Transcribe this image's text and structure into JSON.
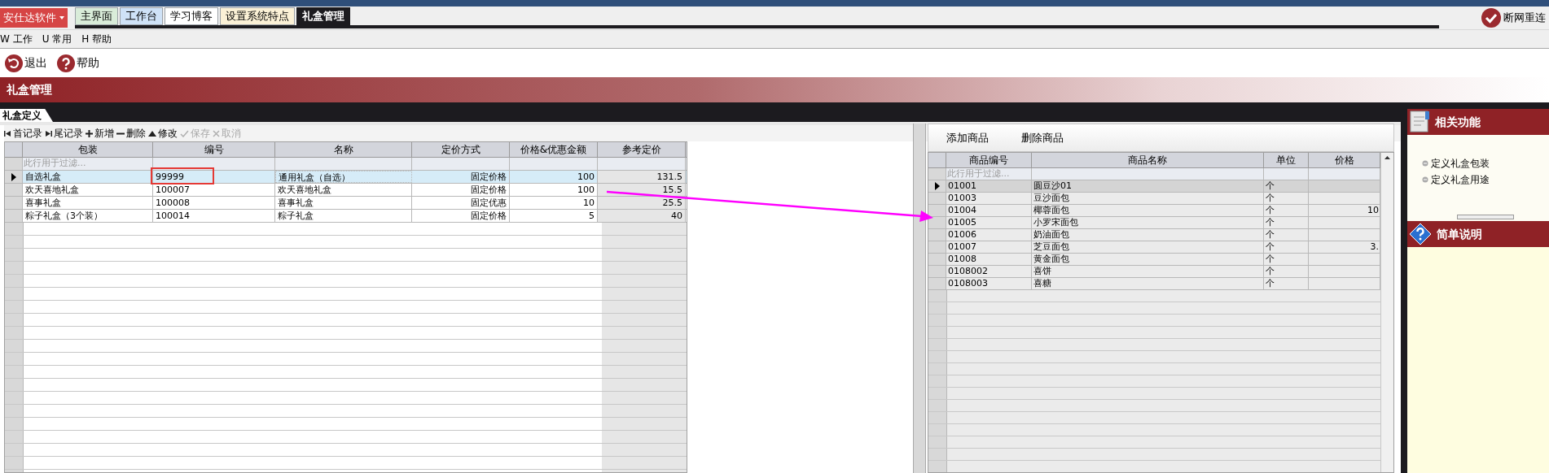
{
  "app_menu": "安仕达软件",
  "tabs": [
    {
      "label": "主界面",
      "selected": false,
      "color": "#d9ecd9"
    },
    {
      "label": "工作台",
      "selected": false,
      "color": "#cfe2f7"
    },
    {
      "label": "学习博客",
      "selected": false,
      "color": "#ffffff"
    },
    {
      "label": "设置系统特点",
      "selected": false,
      "color": "#fbf1d6"
    },
    {
      "label": "礼盒管理",
      "selected": true,
      "color": "#1c1b1f"
    }
  ],
  "status": {
    "label": "断网重连"
  },
  "menu": [
    {
      "key": "W",
      "label": "工作"
    },
    {
      "key": "U",
      "label": "常用"
    },
    {
      "key": "H",
      "label": "帮助"
    }
  ],
  "toolbar": [
    {
      "kind": "exit",
      "label": "退出"
    },
    {
      "kind": "help",
      "label": "帮助"
    }
  ],
  "banner": "礼盒管理",
  "subtab": "礼盒定义",
  "grid_toolbar": [
    {
      "kind": "first",
      "label": "首记录",
      "disabled": false
    },
    {
      "kind": "last",
      "label": "尾记录",
      "disabled": false
    },
    {
      "kind": "add",
      "label": "新增",
      "disabled": false
    },
    {
      "kind": "delete",
      "label": "删除",
      "disabled": false
    },
    {
      "kind": "edit",
      "label": "修改",
      "disabled": false
    },
    {
      "kind": "save",
      "label": "保存",
      "disabled": true
    },
    {
      "kind": "cancel",
      "label": "取消",
      "disabled": true
    }
  ],
  "gift_table": {
    "columns": [
      "包装",
      "编号",
      "名称",
      "定价方式",
      "价格&优惠金额",
      "参考定价"
    ],
    "filter_hint": "此行用于过滤...",
    "rows": [
      {
        "selected": true,
        "cells": [
          "自选礼盒",
          "99999",
          "通用礼盒（自选）",
          "固定价格",
          "100",
          "131.5"
        ]
      },
      {
        "selected": false,
        "cells": [
          "欢天喜地礼盒",
          "100007",
          "欢天喜地礼盒",
          "固定价格",
          "100",
          "15.5"
        ]
      },
      {
        "selected": false,
        "cells": [
          "喜事礼盒",
          "100008",
          "喜事礼盒",
          "固定优惠",
          "10",
          "25.5"
        ]
      },
      {
        "selected": false,
        "cells": [
          "粽子礼盒（3个装）",
          "100014",
          "粽子礼盒",
          "固定价格",
          "5",
          "40"
        ]
      }
    ]
  },
  "product_panel": {
    "buttons": [
      "添加商品",
      "删除商品"
    ],
    "columns": [
      "商品编号",
      "商品名称",
      "单位",
      "价格"
    ],
    "filter_hint": "此行用于过滤...",
    "rows": [
      {
        "selected": true,
        "cells": [
          "01001",
          "圆豆沙01",
          "个",
          ""
        ]
      },
      {
        "selected": false,
        "cells": [
          "01003",
          "豆沙面包",
          "个",
          ""
        ]
      },
      {
        "selected": false,
        "cells": [
          "01004",
          "椰蓉面包",
          "个",
          "10"
        ]
      },
      {
        "selected": false,
        "cells": [
          "01005",
          "小罗宋面包",
          "个",
          ""
        ]
      },
      {
        "selected": false,
        "cells": [
          "01006",
          "奶油面包",
          "个",
          ""
        ]
      },
      {
        "selected": false,
        "cells": [
          "01007",
          "芝豆面包",
          "个",
          "3."
        ]
      },
      {
        "selected": false,
        "cells": [
          "01008",
          "黄金面包",
          "个",
          ""
        ]
      },
      {
        "selected": false,
        "cells": [
          "0108002",
          "喜饼",
          "个",
          ""
        ]
      },
      {
        "selected": false,
        "cells": [
          "0108003",
          "喜糖",
          "个",
          ""
        ]
      }
    ]
  },
  "sidebar": [
    {
      "kind": "functions",
      "title": "相关功能",
      "items": [
        "定义礼盒包装",
        "定义礼盒用途"
      ]
    },
    {
      "kind": "help",
      "title": "简单说明"
    }
  ]
}
